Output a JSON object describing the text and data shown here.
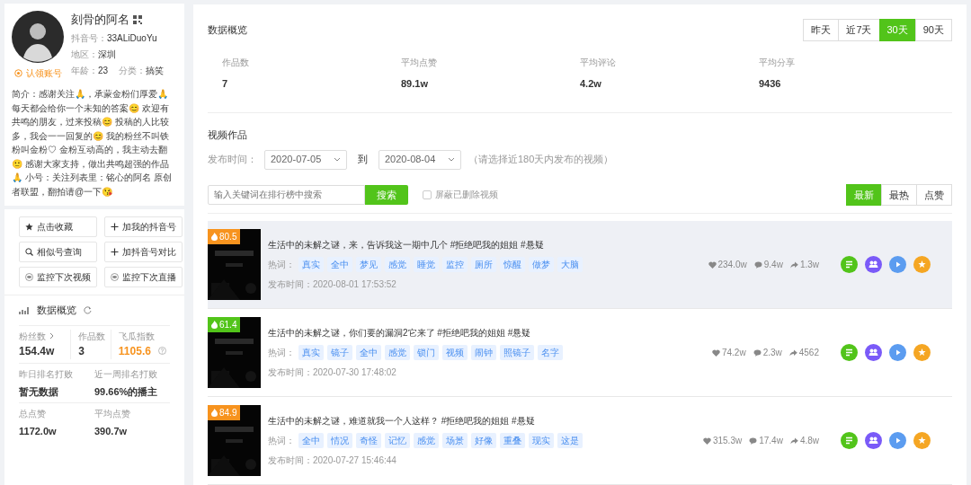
{
  "profile": {
    "name": "刻骨的阿名",
    "id_label": "抖音号：",
    "id": "33ALiDuoYu",
    "region_label": "地区：",
    "region": "深圳",
    "age_label": "年龄：",
    "age": "23",
    "category_label": "分类：",
    "category": "搞笑",
    "claim": "认领账号",
    "bio": "简介：感谢关注🙏，承蒙金粉们厚爱🙏 每天都会给你一个未知的答案😊 欢迎有共鸣的朋友，过来投稿😊 投稿的人比较多，我会一一回复的😊 我的粉丝不叫铁粉叫金粉♡ 金粉互动高的，我主动去翻🙂 感谢大家支持，做出共鸣超强的作品🙏 小号：关注列表里：铭心的阿名 原创者联盟，翻拍请@一下😘"
  },
  "actions": [
    {
      "label": "点击收藏",
      "kind": "star"
    },
    {
      "label": "加我的抖音号",
      "kind": "plus"
    },
    {
      "label": "相似号查询",
      "kind": "search"
    },
    {
      "label": "加抖音号对比",
      "kind": "plus"
    },
    {
      "label": "监控下次视频",
      "kind": "eye"
    },
    {
      "label": "监控下次直播",
      "kind": "eye"
    }
  ],
  "side_overview": {
    "title": "数据概览",
    "stats": [
      {
        "label": "粉丝数",
        "value": "154.4w",
        "kind": "link"
      },
      {
        "label": "作品数",
        "value": "3",
        "kind": "plain"
      },
      {
        "label": "飞瓜指数",
        "value": "1105.6",
        "kind": "index"
      }
    ],
    "pairs": [
      {
        "label": "昨日排名打败",
        "value": "暂无数据"
      },
      {
        "label": "近一周排名打败",
        "value": "99.66%的播主"
      },
      {
        "label": "总点赞",
        "value": "1172.0w"
      },
      {
        "label": "平均点赞",
        "value": "390.7w"
      }
    ]
  },
  "overview": {
    "title": "数据概览",
    "ranges": [
      {
        "label": "昨天",
        "selected": false
      },
      {
        "label": "近7天",
        "selected": false
      },
      {
        "label": "30天",
        "selected": true
      },
      {
        "label": "90天",
        "selected": false
      }
    ],
    "stats": [
      {
        "label": "作品数",
        "value": "7"
      },
      {
        "label": "平均点赞",
        "value": "89.1w"
      },
      {
        "label": "平均评论",
        "value": "4.2w"
      },
      {
        "label": "平均分享",
        "value": "9436"
      }
    ]
  },
  "videos": {
    "title": "视频作品",
    "date_label": "发布时间：",
    "date_from": "2020-07-05",
    "to_label": "到",
    "date_to": "2020-08-04",
    "date_hint": "（请选择近180天内发布的视频）",
    "search": {
      "placeholder": "输入关键词在排行榜中搜索",
      "button": "搜索"
    },
    "hide_deleted": {
      "label": "屏蔽已删除视频",
      "checked": false
    },
    "sorts": [
      {
        "label": "最新",
        "selected": true
      },
      {
        "label": "最热",
        "selected": false
      },
      {
        "label": "点赞",
        "selected": false
      }
    ],
    "items": [
      {
        "heat": "80.5",
        "color": "#f7931e",
        "selected": true,
        "title": "生活中的未解之谜，来，告诉我这一期中几个 #拒绝吧我的姐姐 #悬疑",
        "hot_label": "热词：",
        "tags": [
          "真实",
          "全中",
          "梦见",
          "感觉",
          "睡觉",
          "监控",
          "厕所",
          "惊醒",
          "做梦",
          "大脑"
        ],
        "time": "发布时间：2020-08-01 17:53:52",
        "likes": "234.0w",
        "comments": "9.4w",
        "shares": "1.3w"
      },
      {
        "heat": "61.4",
        "color": "#52c41a",
        "selected": false,
        "title": "生活中的未解之谜，你们要的漏洞2它来了 #拒绝吧我的姐姐 #悬疑",
        "hot_label": "热词：",
        "tags": [
          "真实",
          "镜子",
          "全中",
          "感觉",
          "锁门",
          "视频",
          "闹钟",
          "照镜子",
          "名字"
        ],
        "time": "发布时间：2020-07-30 17:48:02",
        "likes": "74.2w",
        "comments": "2.3w",
        "shares": "4562"
      },
      {
        "heat": "84.9",
        "color": "#f7931e",
        "selected": false,
        "title": "生活中的未解之谜，难道就我一个人这样？ #拒绝吧我的姐姐 #悬疑",
        "hot_label": "热词：",
        "tags": [
          "全中",
          "情况",
          "奇怪",
          "记忆",
          "感觉",
          "场景",
          "好像",
          "重叠",
          "现实",
          "这是"
        ],
        "time": "发布时间：2020-07-27 15:46:44",
        "likes": "315.3w",
        "comments": "17.4w",
        "shares": "4.8w"
      }
    ]
  }
}
